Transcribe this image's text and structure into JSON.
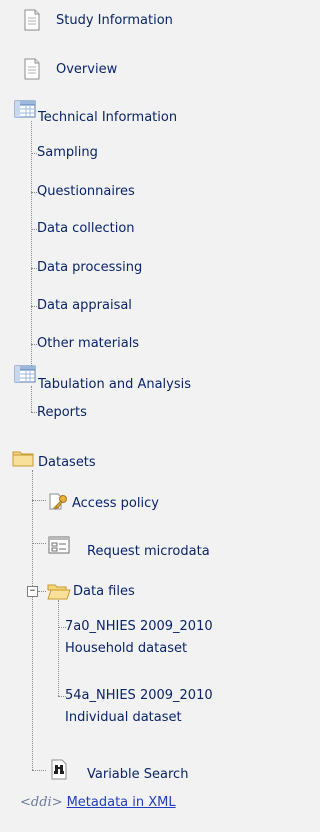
{
  "tree": {
    "study_information": "Study Information",
    "overview": "Overview",
    "technical_information": {
      "label": "Technical Information",
      "children": [
        "Sampling",
        "Questionnaires",
        "Data collection",
        "Data processing",
        "Data appraisal",
        "Other materials"
      ]
    },
    "tabulation": {
      "label": "Tabulation and Analysis",
      "children": [
        "Reports"
      ]
    },
    "datasets": {
      "label": "Datasets",
      "access_policy": "Access policy",
      "request_microdata": "Request microdata",
      "data_files": {
        "label": "Data files",
        "expander": "−",
        "files": [
          {
            "line1": "7a0_NHIES 2009_2010",
            "line2": "Household dataset"
          },
          {
            "line1": "54a_NHIES 2009_2010",
            "line2": "Individual dataset"
          }
        ]
      },
      "variable_search": "Variable Search"
    }
  },
  "footer": {
    "ddi_logo": "<ddi>",
    "metadata_link": "Metadata in XML"
  },
  "icons": {
    "page": "page-icon",
    "folder": "folder-icon",
    "table": "table-icon",
    "key": "key-icon",
    "form": "form-icon",
    "binoculars": "binoculars-icon"
  }
}
